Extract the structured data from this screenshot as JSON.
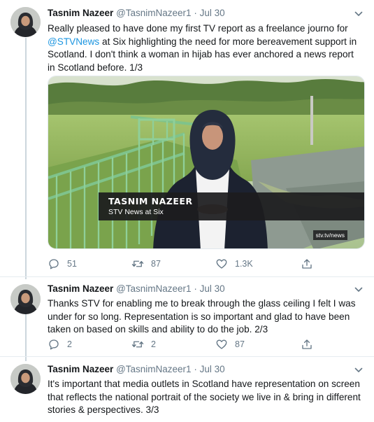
{
  "tweets": [
    {
      "name": "Tasnim Nazeer",
      "handle": "@TasnimNazeer1",
      "dot": "·",
      "date": "Jul 30",
      "text_before": "Really pleased to have done my first TV report as a freelance journo for ",
      "mention": "@STVNews",
      "text_after": " at Six highlighting the need for more bereavement support in Scotland. I don't think a woman in hijab has ever anchored a news report in Scotland before. 1/3",
      "media": {
        "lower_third_name": "TASNIM NAZEER",
        "lower_third_sub": "STV News at Six",
        "url": "stv.tv/news"
      },
      "replies": "51",
      "retweets": "87",
      "likes": "1.3K"
    },
    {
      "name": "Tasnim Nazeer",
      "handle": "@TasnimNazeer1",
      "dot": "·",
      "date": "Jul 30",
      "text": "Thanks STV for enabling me to break through the glass ceiling I felt I was under for so long. Representation is so important  and glad to have been taken on based on skills and ability to do the job. 2/3",
      "replies": "2",
      "retweets": "2",
      "likes": "87"
    },
    {
      "name": "Tasnim Nazeer",
      "handle": "@TasnimNazeer1",
      "dot": "·",
      "date": "Jul 30",
      "text": "It's important that media outlets in Scotland have representation on screen that reflects the national portrait of the society we live in & bring in different stories & perspectives. 3/3"
    }
  ],
  "colors": {
    "text": "#14171a",
    "secondary": "#657786",
    "link": "#1b95e0",
    "border": "#e6ecf0",
    "thread_line": "#ccd6dd"
  },
  "icons": {
    "reply": "reply-icon",
    "retweet": "retweet-icon",
    "like": "heart-icon",
    "share": "share-icon",
    "caret": "chevron-down-icon"
  }
}
